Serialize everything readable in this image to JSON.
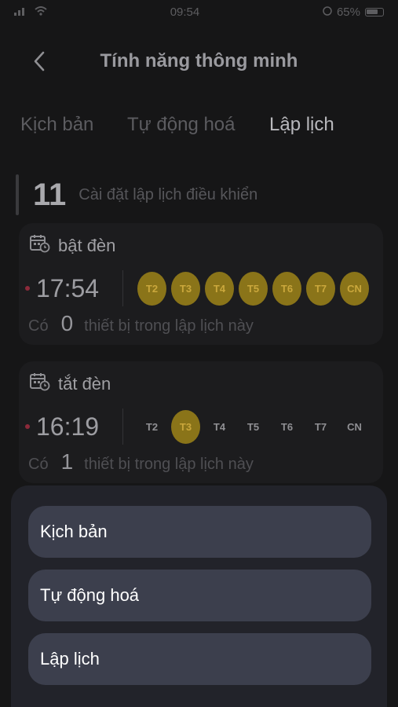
{
  "status_bar": {
    "time": "09:54",
    "battery_text": "65%"
  },
  "header": {
    "title": "Tính năng thông minh"
  },
  "tabs": [
    {
      "label": "Kịch bản",
      "active": false
    },
    {
      "label": "Tự động hoá",
      "active": false
    },
    {
      "label": "Lập lịch",
      "active": true
    }
  ],
  "summary": {
    "count": "11",
    "label": "Cài đặt lập lịch điều khiển"
  },
  "schedules": [
    {
      "name": "bật đèn",
      "time": "17:54",
      "days": [
        {
          "label": "T2",
          "on": true
        },
        {
          "label": "T3",
          "on": true
        },
        {
          "label": "T4",
          "on": true
        },
        {
          "label": "T5",
          "on": true
        },
        {
          "label": "T6",
          "on": true
        },
        {
          "label": "T7",
          "on": true
        },
        {
          "label": "CN",
          "on": true
        }
      ],
      "footer_prefix": "Có",
      "device_count": "0",
      "footer_suffix": "thiết bị trong lập lịch này"
    },
    {
      "name": "tắt đèn",
      "time": "16:19",
      "days": [
        {
          "label": "T2",
          "on": false
        },
        {
          "label": "T3",
          "on": true
        },
        {
          "label": "T4",
          "on": false
        },
        {
          "label": "T5",
          "on": false
        },
        {
          "label": "T6",
          "on": false
        },
        {
          "label": "T7",
          "on": false
        },
        {
          "label": "CN",
          "on": false
        }
      ],
      "footer_prefix": "Có",
      "device_count": "1",
      "footer_suffix": "thiết bị trong lập lịch này"
    }
  ],
  "sheet": {
    "items": [
      {
        "label": "Kịch bản"
      },
      {
        "label": "Tự động hoá"
      },
      {
        "label": "Lập lịch"
      }
    ]
  },
  "colors": {
    "background": "#161617",
    "card": "#1c1c1e",
    "day_active": "#8a7419",
    "sheet": "#22232a",
    "sheet_item": "#3c3f4d"
  }
}
